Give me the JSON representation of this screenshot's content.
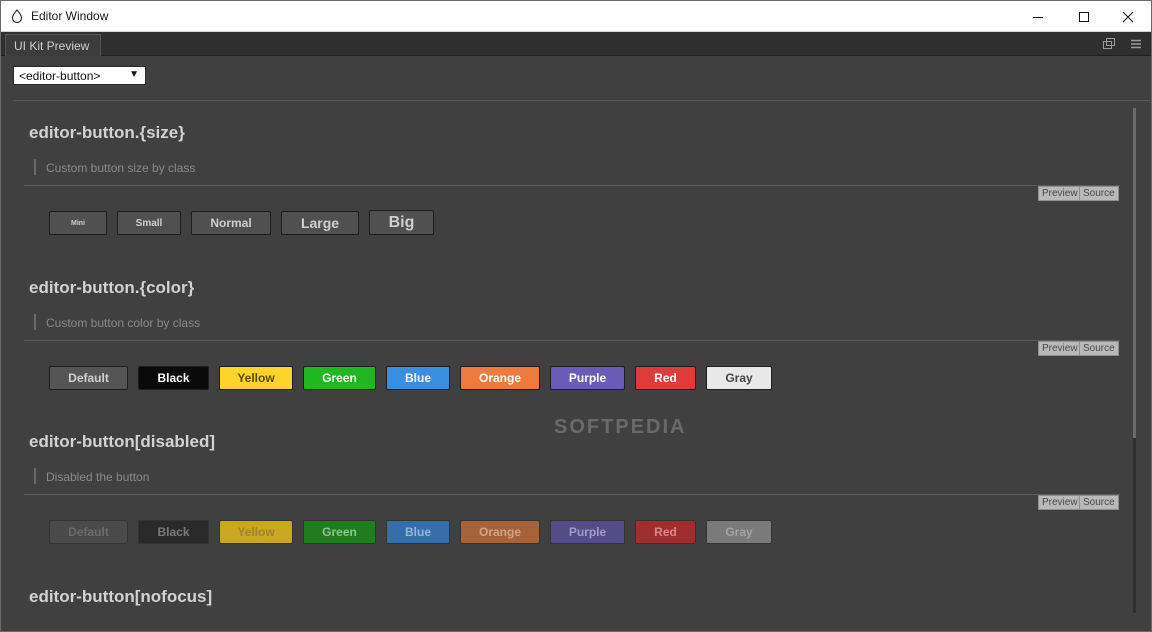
{
  "window": {
    "title": "Editor Window"
  },
  "tab": {
    "label": "UI Kit Preview"
  },
  "selector": {
    "value": "<editor-button>"
  },
  "minitabs": {
    "preview": "Preview",
    "source": "Source"
  },
  "sections": [
    {
      "title": "editor-button.{size}",
      "desc": "Custom button size by class",
      "buttons": [
        "Mini",
        "Small",
        "Normal",
        "Large",
        "Big"
      ]
    },
    {
      "title": "editor-button.{color}",
      "desc": "Custom button color by class",
      "buttons": [
        "Default",
        "Black",
        "Yellow",
        "Green",
        "Blue",
        "Orange",
        "Purple",
        "Red",
        "Gray"
      ]
    },
    {
      "title": "editor-button[disabled]",
      "desc": "Disabled the button",
      "buttons": [
        "Default",
        "Black",
        "Yellow",
        "Green",
        "Blue",
        "Orange",
        "Purple",
        "Red",
        "Gray"
      ]
    },
    {
      "title": "editor-button[nofocus]"
    }
  ],
  "colors": {
    "default": "#555555",
    "black": "#0a0a0a",
    "yellow": "#ffd42a",
    "green": "#1fb91f",
    "blue": "#3a8ee0",
    "orange": "#ee7b3d",
    "purple": "#6b5bb8",
    "red": "#e03a3a",
    "gray": "#e8e8e8"
  },
  "watermark": "SOFTPEDIA"
}
